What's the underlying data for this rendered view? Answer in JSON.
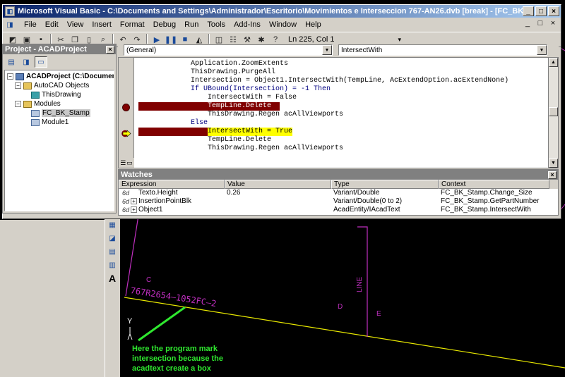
{
  "window": {
    "title": "Microsoft Visual Basic - C:\\Documents and Settings\\Administrador\\Escritorio\\Movimientos e Interseccion 767-AN26.dvb [break] - [FC_BK_Stamp (Code)]",
    "minimize": "_",
    "maximize": "□",
    "close": "×"
  },
  "menubar": {
    "items": [
      "File",
      "Edit",
      "View",
      "Insert",
      "Format",
      "Debug",
      "Run",
      "Tools",
      "Add-Ins",
      "Window",
      "Help"
    ],
    "right_controls": [
      "_",
      "□",
      "×"
    ]
  },
  "toolbar": {
    "position": "Ln 225, Col 1"
  },
  "project": {
    "title": "Project - ACADProject",
    "close": "×",
    "tree": {
      "root": "ACADProject (C:\\Documents",
      "autocad_objects": "AutoCAD Objects",
      "this_drawing": "ThisDrawing",
      "modules": "Modules",
      "fc_bk_stamp": "FC_BK_Stamp",
      "module1": "Module1"
    }
  },
  "code": {
    "object_combo": "(General)",
    "proc_combo": "IntersectWith",
    "lines": [
      "Application.ZoomExtents",
      "ThisDrawing.PurgeAll",
      "Intersection = Object1.IntersectWith(TempLine, AcExtendOption.acExtendNone)",
      "If UBound(Intersection) = -1 Then",
      "IntersectWith = False",
      "TempLine.Delete",
      "ThisDrawing.Regen acAllViewports",
      "Else",
      "IntersectWith = True",
      "TempLine.Delete",
      "ThisDrawing.Regen acAllViewports"
    ]
  },
  "watches": {
    "title": "Watches",
    "close": "×",
    "columns": [
      "Expression",
      "Value",
      "Type",
      "Context"
    ],
    "rows": [
      {
        "icon": "6d",
        "expr": "Texto.Height",
        "value": "0.26",
        "type": "Variant/Double",
        "context": "FC_BK_Stamp.Change_Size",
        "expand": ""
      },
      {
        "icon": "6d",
        "expr": "InsertionPointBlk",
        "value": "",
        "type": "Variant/Double(0 to 2)",
        "context": "FC_BK_Stamp.GetPartNumber",
        "expand": "+"
      },
      {
        "icon": "6d",
        "expr": "Object1",
        "value": "",
        "type": "AcadEntity/IAcadText",
        "context": "FC_BK_Stamp.IntersectWith",
        "expand": "+"
      }
    ]
  },
  "drawing": {
    "label_c": "C",
    "label_d": "D",
    "label_e": "E",
    "vertical_text": "LINE",
    "slanted_text": "767R2654—1052FC—2",
    "ucs_y": "Y",
    "note_lines": [
      "Here the program mark",
      "intersection because the",
      "acadtext create a box"
    ],
    "text_tool": "A"
  },
  "colors": {
    "breakpoint": "#800000",
    "execution": "#ffff00",
    "keyword": "#000080",
    "magenta": "#c02fc0",
    "cad_line": "#f0f000",
    "note_green": "#2fe82f"
  }
}
